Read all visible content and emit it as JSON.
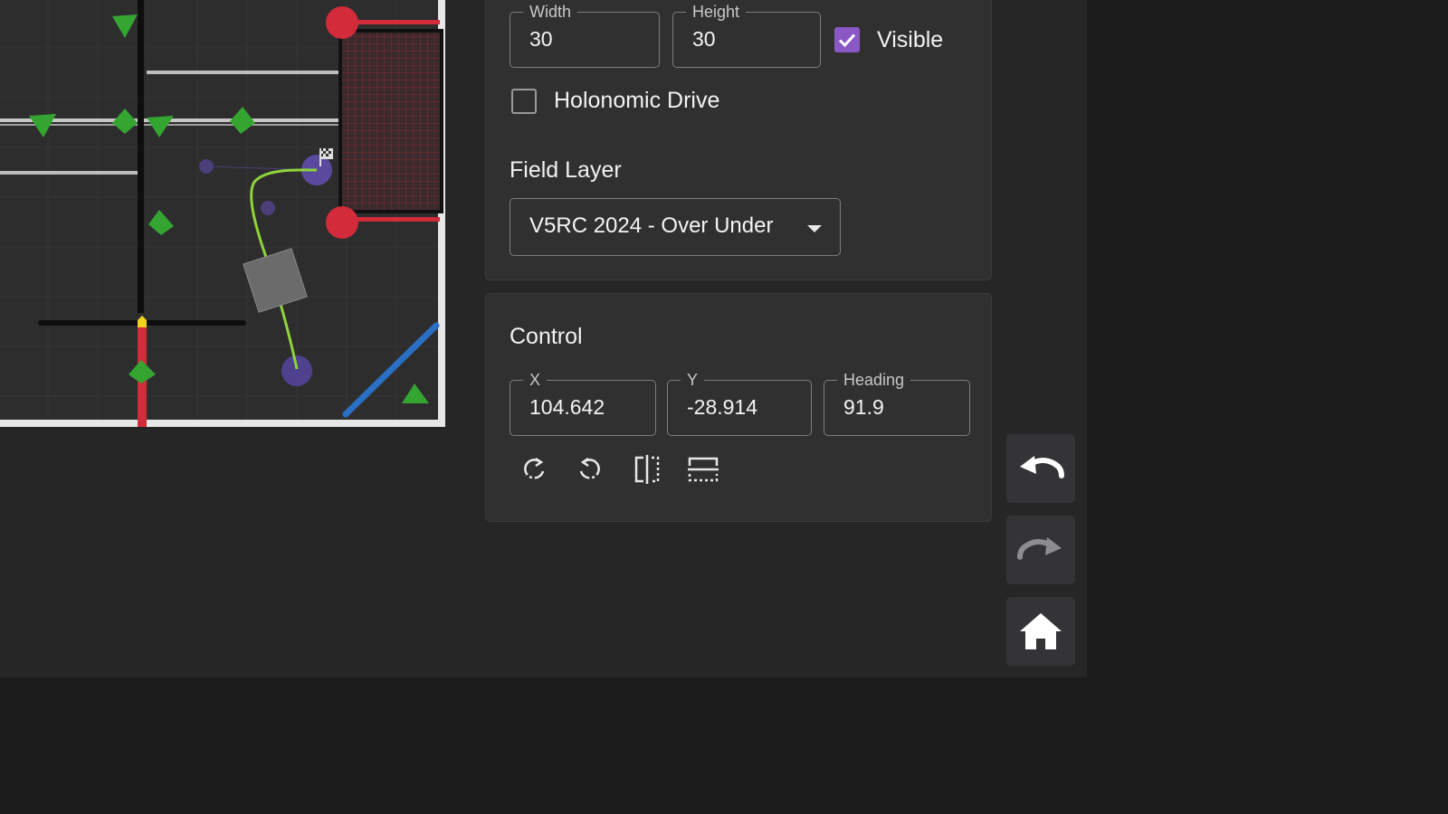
{
  "robot": {
    "width_label": "Width",
    "width_value": "30",
    "height_label": "Height",
    "height_value": "30",
    "visible_label": "Visible",
    "visible_checked": true,
    "holonomic_label": "Holonomic Drive",
    "holonomic_checked": false
  },
  "field_layer": {
    "title": "Field Layer",
    "selected": "V5RC 2024 - Over Under"
  },
  "control": {
    "title": "Control",
    "x_label": "X",
    "x_value": "104.642",
    "y_label": "Y",
    "y_value": "-28.914",
    "heading_label": "Heading",
    "heading_value": "91.9",
    "tools": [
      "rotate-clockwise-icon",
      "rotate-counterclockwise-icon",
      "flip-horizontal-icon",
      "flip-vertical-icon"
    ]
  },
  "side_buttons": [
    "undo-icon",
    "redo-icon",
    "home-icon"
  ],
  "colors": {
    "accent_purple": "#8a58c5",
    "path_green": "#8ed43a",
    "goal_red": "#d22b3a",
    "barrier_blue": "#2a6fc4"
  }
}
